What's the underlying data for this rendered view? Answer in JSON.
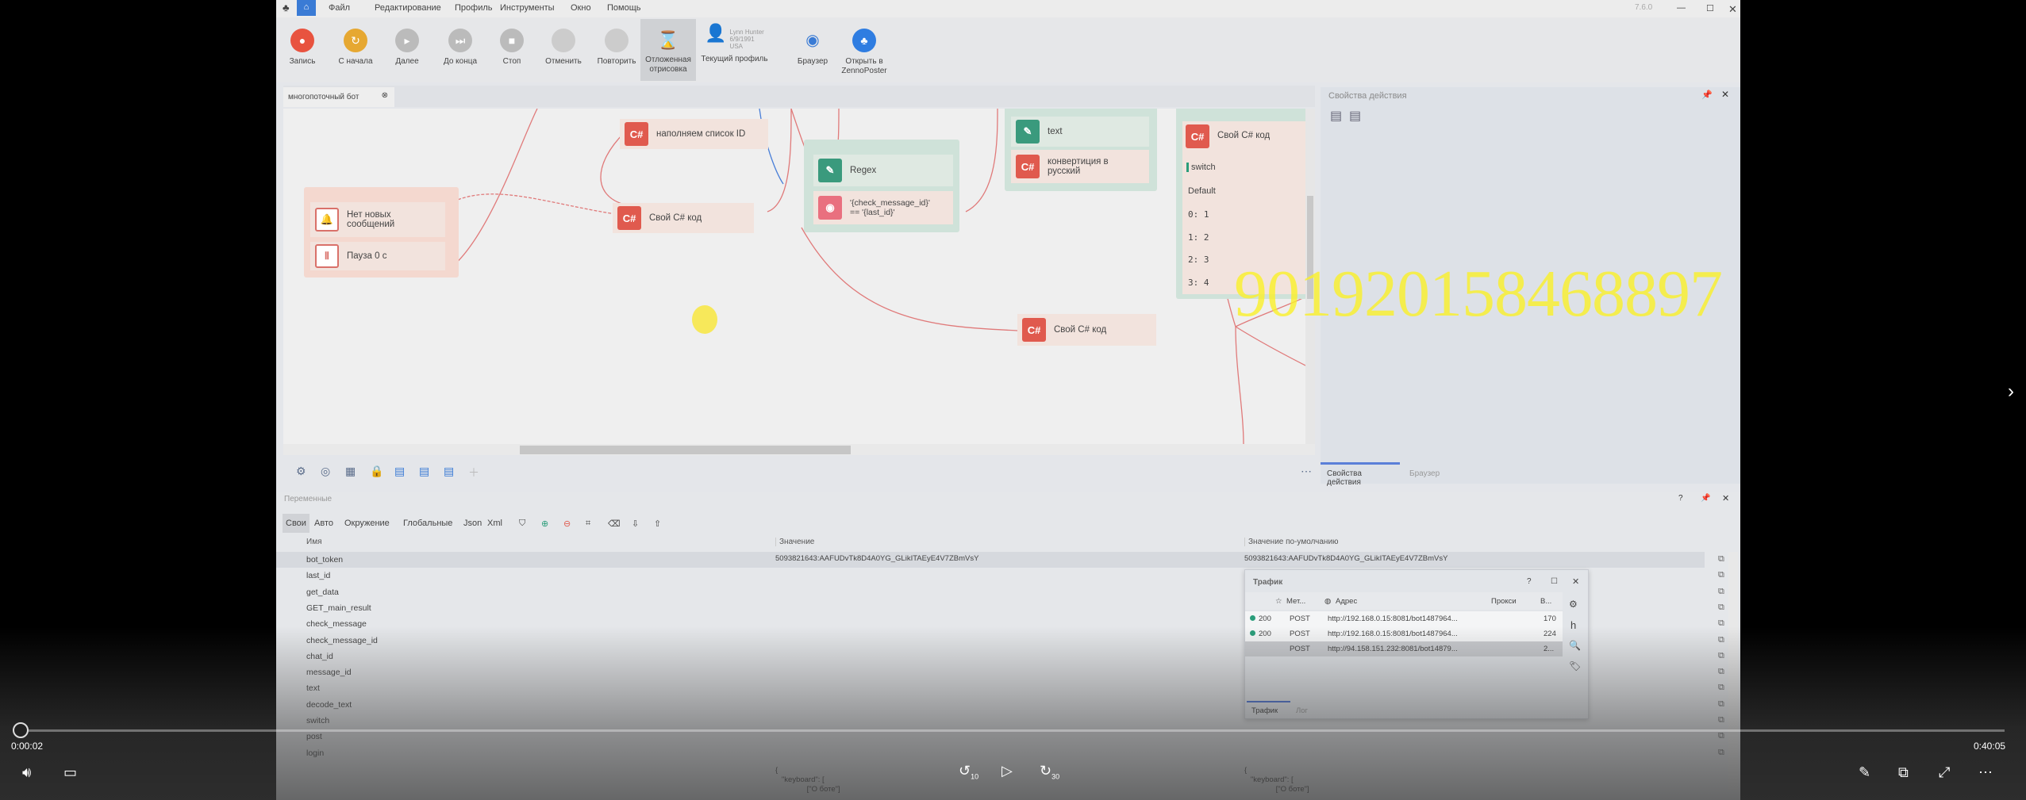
{
  "menu": {
    "items": [
      "Файл",
      "Редактирование",
      "Профиль",
      "Инструменты",
      "Окно",
      "Помощь"
    ],
    "version": "7.6.0"
  },
  "toolbar": {
    "buttons": [
      "Запись",
      "С начала",
      "Далее",
      "До конца",
      "Стоп",
      "Отменить",
      "Повторить",
      "Отложенная отрисовка"
    ],
    "profile": {
      "name": "Lynn Hunter",
      "dob": "6/9/1991",
      "country": "USA",
      "label": "Текущий профиль"
    },
    "browser": "Браузер",
    "open_zp": "Открыть в ZennoPoster"
  },
  "document_tab": "многопоточный бот",
  "canvas": {
    "no_messages": "Нет новых сообщений",
    "pause": "Пауза 0 с",
    "fill_ids": "наполняем список ID",
    "own_cs": "Свой C# код",
    "cs_badge": "C#",
    "regex": "Regex",
    "condition": "'{check_message_id}' == '{last_id}'",
    "text": "text",
    "convert": "конвертиция в русский",
    "switch_label": "switch",
    "switch_cases": [
      "Default",
      "0: 1",
      "1: 2",
      "2: 3",
      "3: 4"
    ]
  },
  "right_panel": {
    "title": "Свойства действия",
    "tabs": [
      "Свойства действия",
      "Браузер"
    ]
  },
  "variables": {
    "title": "Переменные",
    "tabs": [
      "Свои",
      "Авто",
      "Окружение",
      "Глобальные",
      "Json",
      "Xml"
    ],
    "columns": [
      "Имя",
      "Значение",
      "Значение по-умолчанию"
    ],
    "rows": [
      {
        "name": "bot_token",
        "value": "5093821643:AAFUDvTk8D4A0YG_GLikITAEyE4V7ZBmVsY",
        "default": "5093821643:AAFUDvTk8D4A0YG_GLikITAEyE4V7ZBmVsY"
      },
      {
        "name": "last_id"
      },
      {
        "name": "get_data"
      },
      {
        "name": "GET_main_result"
      },
      {
        "name": "check_message"
      },
      {
        "name": "check_message_id"
      },
      {
        "name": "chat_id"
      },
      {
        "name": "message_id"
      },
      {
        "name": "text"
      },
      {
        "name": "decode_text"
      },
      {
        "name": "switch"
      },
      {
        "name": "post"
      },
      {
        "name": "login"
      }
    ],
    "json_preview": "{\n   \"keyboard\": [\n               [\"О боте\"]"
  },
  "traffic": {
    "title": "Трафик",
    "columns": [
      "Мет...",
      "Адрес",
      "Прокси",
      "В..."
    ],
    "rows": [
      {
        "status": "200",
        "method": "POST",
        "url": "http://192.168.0.15:8081/bot1487964...",
        "bytes": "170"
      },
      {
        "status": "200",
        "method": "POST",
        "url": "http://192.168.0.15:8081/bot1487964...",
        "bytes": "224"
      },
      {
        "status": "",
        "method": "POST",
        "url": "http://94.158.151.232:8081/bot14879...",
        "bytes": "2..."
      }
    ],
    "tabs": [
      "Трафик",
      "Лог"
    ]
  },
  "video": {
    "current": "0:00:02",
    "total": "0:40:05",
    "progress": 0.001,
    "rewind": "10",
    "forward": "30"
  },
  "watermark": "901920158468897",
  "colors": {
    "accent": "#3a7bd5",
    "cs": "#e05a4e",
    "green": "#3a9a7d",
    "link": "#e07070"
  }
}
